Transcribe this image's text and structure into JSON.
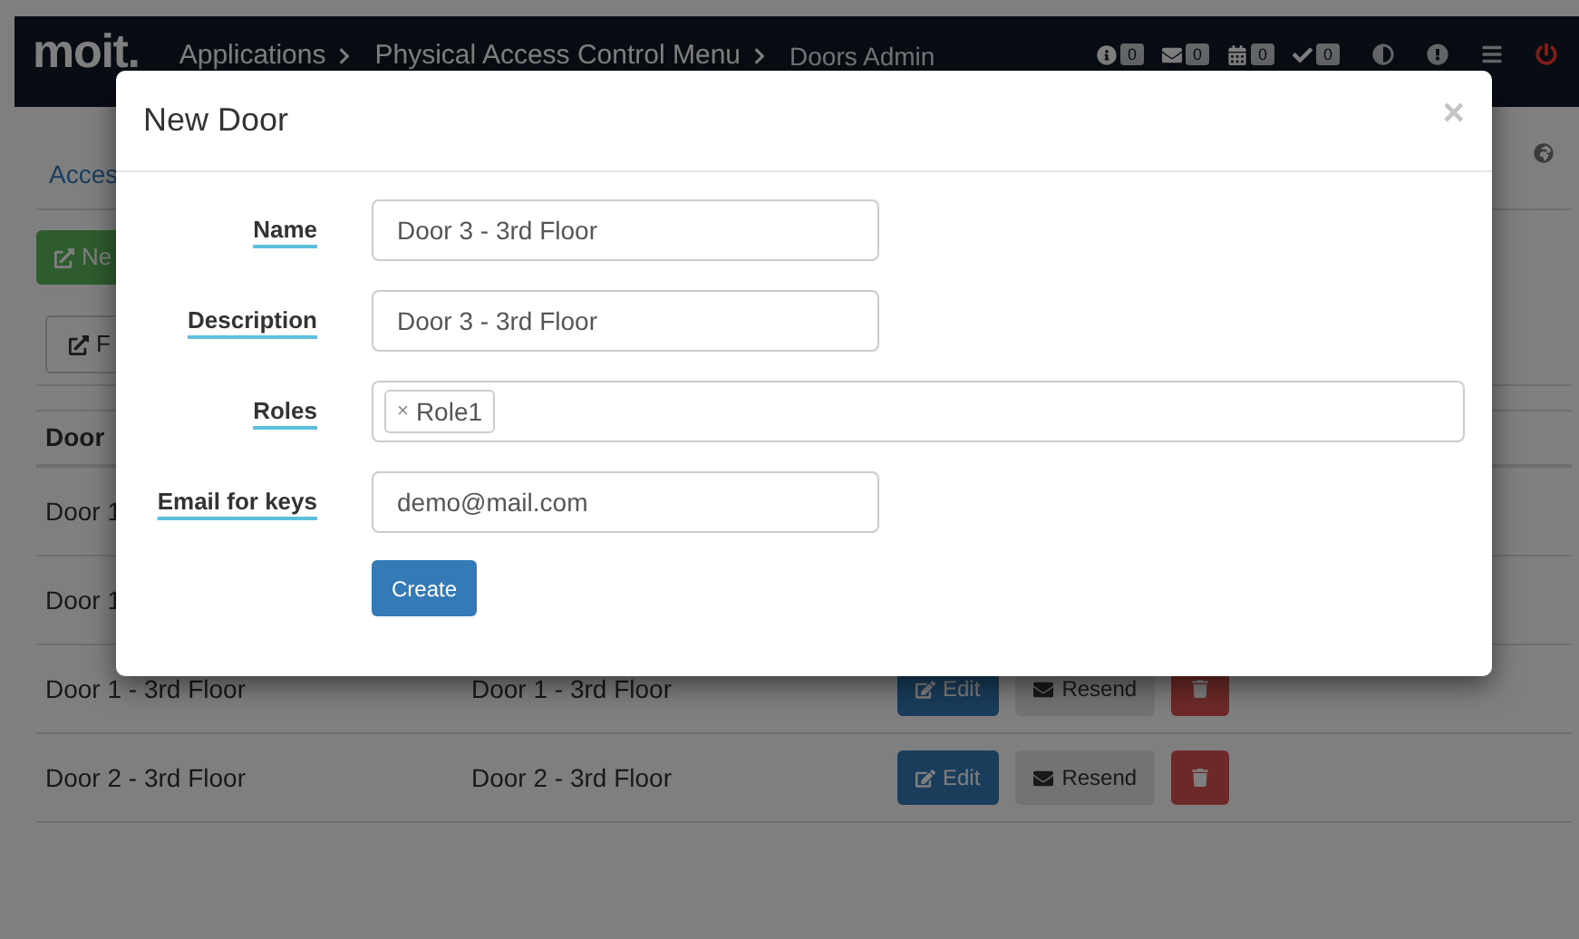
{
  "nav": {
    "logo": "moit.",
    "breadcrumbs": [
      {
        "label": "Applications"
      },
      {
        "label": "Physical Access Control Menu"
      },
      {
        "label": "Doors Admin"
      }
    ],
    "indicators": [
      {
        "kind": "info",
        "count": "0"
      },
      {
        "kind": "mail",
        "count": "0"
      },
      {
        "kind": "calendar",
        "count": "0"
      },
      {
        "kind": "check",
        "count": "0"
      }
    ],
    "actions": [
      {
        "kind": "contrast"
      },
      {
        "kind": "alert"
      },
      {
        "kind": "menu"
      },
      {
        "kind": "power"
      }
    ]
  },
  "page": {
    "breadcrumb": "Acces",
    "new_button": "Ne",
    "tool_button": "F",
    "table": {
      "header": "Door",
      "rows": [
        {
          "name": "Door 1"
        },
        {
          "name": "Door 1"
        },
        {
          "name": "Door 1 - 3rd Floor",
          "description": "Door 1 - 3rd Floor",
          "edit": "Edit",
          "resend": "Resend"
        },
        {
          "name": "Door 2 - 3rd Floor",
          "description": "Door 2 - 3rd Floor",
          "edit": "Edit",
          "resend": "Resend"
        }
      ]
    }
  },
  "modal": {
    "title": "New Door",
    "close": "×",
    "fields": [
      {
        "kind": "text",
        "label": "Name",
        "value": "Door 3 - 3rd Floor"
      },
      {
        "kind": "text",
        "label": "Description",
        "value": "Door 3 - 3rd Floor"
      },
      {
        "kind": "tags",
        "label": "Roles",
        "tags": [
          {
            "remove": "×",
            "label": "Role1"
          }
        ]
      },
      {
        "kind": "text",
        "label": "Email for keys",
        "value": "demo@mail.com"
      }
    ],
    "submit": "Create"
  }
}
